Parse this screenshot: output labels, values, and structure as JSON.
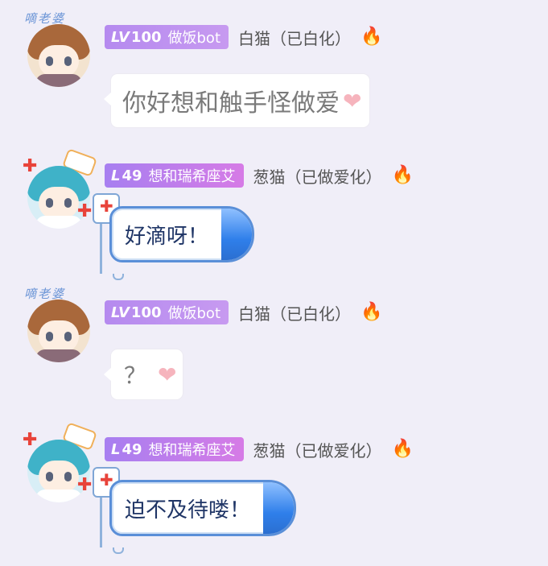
{
  "messages": [
    {
      "sender": "bot",
      "lv_prefix": "LV",
      "lv_number": "100",
      "title": "做饭bot",
      "nickname": "白猫（已白化）",
      "avatar_text": "嘀老婆",
      "text": "你好想和触手怪做爱",
      "emoji": "heart-icon"
    },
    {
      "sender": "leek",
      "lv_prefix": "L",
      "lv_number": "49",
      "title": "想和瑞希座艾",
      "nickname": "葱猫（已做爱化）",
      "text": "好滴呀！"
    },
    {
      "sender": "bot",
      "lv_prefix": "LV",
      "lv_number": "100",
      "title": "做饭bot",
      "nickname": "白猫（已白化）",
      "avatar_text": "嘀老婆",
      "text": "？",
      "emoji": "heart-icon"
    },
    {
      "sender": "leek",
      "lv_prefix": "L",
      "lv_number": "49",
      "title": "想和瑞希座艾",
      "nickname": "葱猫（已做爱化）",
      "text": "迫不及待喽！"
    }
  ],
  "colors": {
    "background": "#f0eef8",
    "badge_purple": "#b58aef",
    "badge_pink": "#d67be6",
    "nickname": "#555555",
    "bubble_text_bot": "#7a7a7a",
    "bubble_text_leek": "#1f3566",
    "bubble_border_leek": "#5a8fd8"
  }
}
